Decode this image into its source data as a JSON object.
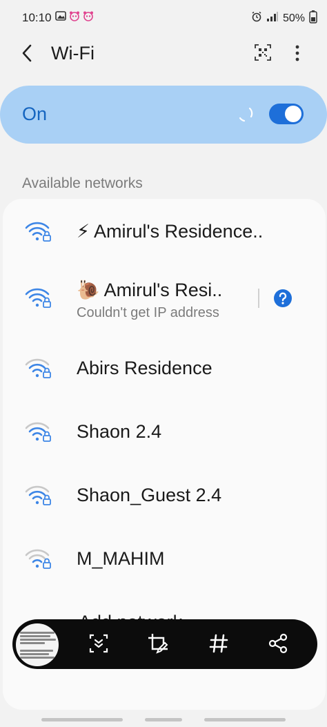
{
  "status_bar": {
    "time": "10:10",
    "battery": "50%",
    "icons": [
      "image-icon",
      "panda-icon",
      "panda-icon",
      "alarm-icon",
      "signal-icon",
      "battery-icon"
    ]
  },
  "header": {
    "title": "Wi-Fi",
    "icons": [
      "back-icon",
      "qr-scan-icon",
      "more-options-icon"
    ]
  },
  "wifi_toggle": {
    "label": "On",
    "state": true,
    "accent_color": "#1e6fd9",
    "card_color": "#a9d0f5"
  },
  "available_networks": {
    "title": "Available networks",
    "items": [
      {
        "name": "⚡ Amirul's Residence..",
        "secured": true,
        "signal": "strong"
      },
      {
        "name": "🐌 Amirul's Resi..",
        "subtitle": "Couldn't get IP address",
        "secured": true,
        "signal": "strong",
        "has_help": true
      },
      {
        "name": "Abirs Residence",
        "secured": true,
        "signal": "medium"
      },
      {
        "name": "Shaon 2.4",
        "secured": true,
        "signal": "medium"
      },
      {
        "name": "Shaon_Guest 2.4",
        "secured": true,
        "signal": "medium"
      },
      {
        "name": "M_MAHIM",
        "secured": true,
        "signal": "weak"
      }
    ],
    "partial_item": "Add network"
  },
  "screenshot_toolbar": {
    "icons": [
      "scroll-capture-icon",
      "crop-edit-icon",
      "hashtag-icon",
      "share-icon"
    ]
  }
}
